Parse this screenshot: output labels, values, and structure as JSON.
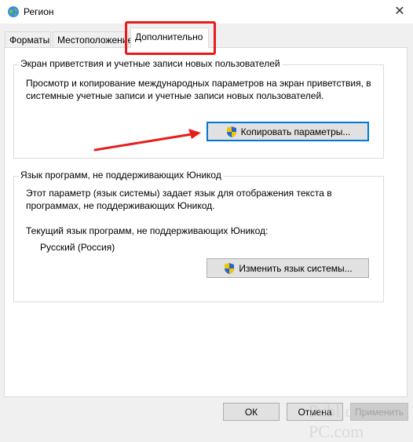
{
  "window": {
    "title": "Регион",
    "close_glyph": "✕"
  },
  "tabs": [
    {
      "label": "Форматы",
      "active": false
    },
    {
      "label": "Местоположение",
      "active": false
    },
    {
      "label": "Дополнительно",
      "active": true
    }
  ],
  "welcome_group": {
    "legend": "Экран приветствия и учетные записи новых пользователей",
    "description": "Просмотр и копирование международных параметров на экран приветствия, в системные учетные записи и учетные записи новых пользователей.",
    "copy_button_label": "Копировать параметры..."
  },
  "unicode_group": {
    "legend": "Язык программ, не поддерживающих Юникод",
    "description": "Этот параметр (язык системы) задает язык для отображения текста в программах, не поддерживающих Юникод.",
    "current_language_caption": "Текущий язык программ, не поддерживающих Юникод:",
    "current_language_value": "Русский (Россия)",
    "change_button_label": "Изменить язык системы..."
  },
  "footer": {
    "ok_label": "ОК",
    "cancel_label": "Отмена",
    "apply_label": "Применить"
  },
  "watermark": "Public-PC.com",
  "colors": {
    "highlight_red": "#e81c1c",
    "focus_blue": "#0078d7",
    "window_bg": "#f0f0f0",
    "panel_bg": "#ffffff"
  },
  "icons": {
    "app": "globe-icon",
    "close": "close-icon",
    "uac": "uac-shield-icon",
    "annotation": "red-arrow-icon"
  }
}
